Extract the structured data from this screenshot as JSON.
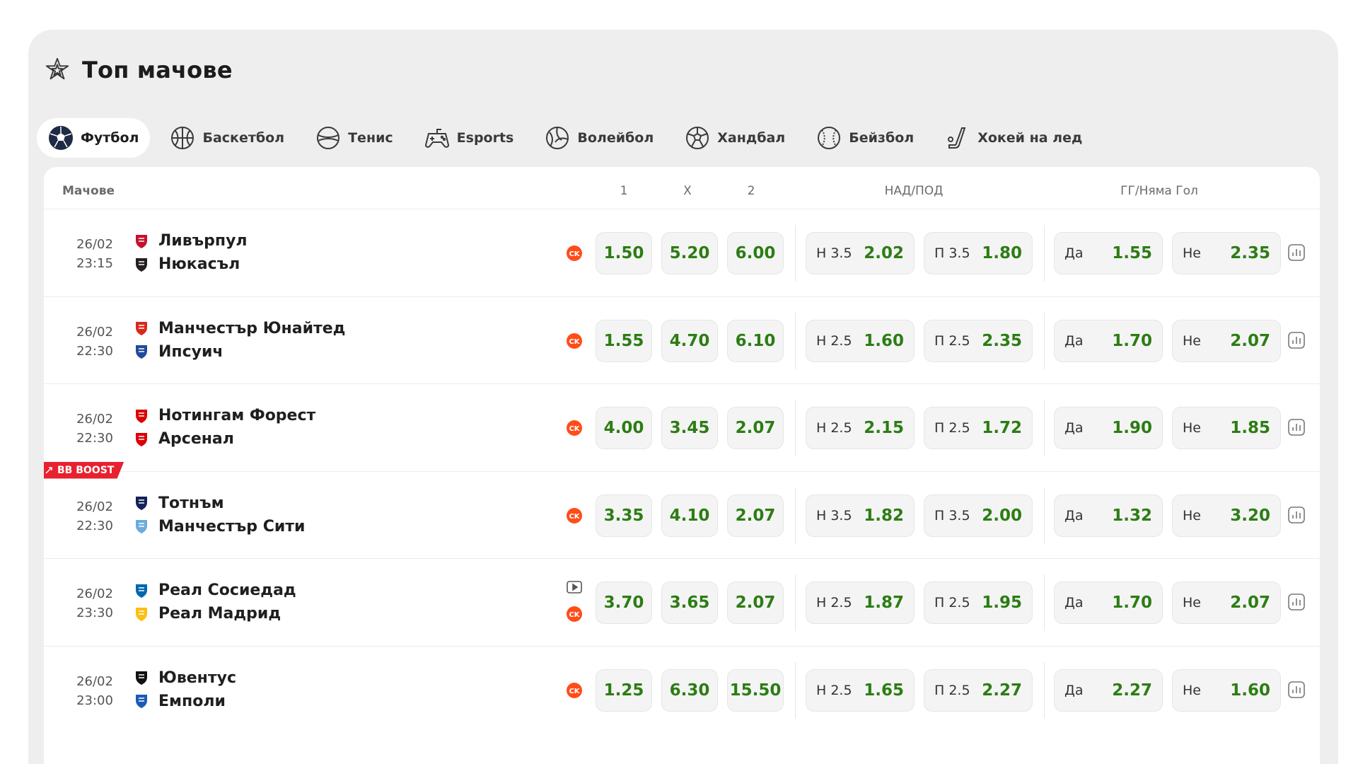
{
  "header": {
    "title": "Топ мачове",
    "icon": "stars-icon"
  },
  "tabs": [
    {
      "label": "Футбол",
      "icon": "football-icon",
      "active": true
    },
    {
      "label": "Баскетбол",
      "icon": "basketball-icon",
      "active": false
    },
    {
      "label": "Тенис",
      "icon": "tennis-icon",
      "active": false
    },
    {
      "label": "Esports",
      "icon": "gamepad-icon",
      "active": false
    },
    {
      "label": "Волейбол",
      "icon": "volleyball-icon",
      "active": false
    },
    {
      "label": "Хандбал",
      "icon": "handball-icon",
      "active": false
    },
    {
      "label": "Бейзбол",
      "icon": "baseball-icon",
      "active": false
    },
    {
      "label": "Хокей на лед",
      "icon": "hockey-icon",
      "active": false
    }
  ],
  "table_header": {
    "matches": "Мачове",
    "col1": "1",
    "colx": "X",
    "col2": "2",
    "over_under": "НАД/ПОД",
    "btts": "ГГ/Няма Гол"
  },
  "colors": {
    "odds_green": "#2c7d14",
    "ck_orange": "#ff4d1a",
    "boost_red": "#e8212f"
  },
  "matches": [
    {
      "date": "26/02",
      "time": "23:15",
      "home": "Ливърпул",
      "away": "Нюкасъл",
      "odd1": "1.50",
      "oddx": "5.20",
      "odd2": "6.00",
      "over_label": "Н 3.5",
      "over": "2.02",
      "under_label": "П 3.5",
      "under": "1.80",
      "yes_label": "Да",
      "yes": "1.55",
      "no_label": "Не",
      "no": "2.35"
    },
    {
      "date": "26/02",
      "time": "22:30",
      "home": "Манчестър Юнайтед",
      "away": "Ипсуич",
      "odd1": "1.55",
      "oddx": "4.70",
      "odd2": "6.10",
      "over_label": "Н 2.5",
      "over": "1.60",
      "under_label": "П 2.5",
      "under": "2.35",
      "yes_label": "Да",
      "yes": "1.70",
      "no_label": "Не",
      "no": "2.07"
    },
    {
      "date": "26/02",
      "time": "22:30",
      "home": "Нотингам Форест",
      "away": "Арсенал",
      "odd1": "4.00",
      "oddx": "3.45",
      "odd2": "2.07",
      "over_label": "Н 2.5",
      "over": "2.15",
      "under_label": "П 2.5",
      "under": "1.72",
      "yes_label": "Да",
      "yes": "1.90",
      "no_label": "Не",
      "no": "1.85"
    },
    {
      "date": "26/02",
      "time": "22:30",
      "home": "Тотнъм",
      "away": "Манчестър Сити",
      "boost": "BB BOOST",
      "odd1": "3.35",
      "oddx": "4.10",
      "odd2": "2.07",
      "over_label": "Н 3.5",
      "over": "1.82",
      "under_label": "П 3.5",
      "under": "2.00",
      "yes_label": "Да",
      "yes": "1.32",
      "no_label": "Не",
      "no": "3.20"
    },
    {
      "date": "26/02",
      "time": "23:30",
      "home": "Реал Сосиедад",
      "away": "Реал Мадрид",
      "odd1": "3.70",
      "oddx": "3.65",
      "odd2": "2.07",
      "over_label": "Н 2.5",
      "over": "1.87",
      "under_label": "П 2.5",
      "under": "1.95",
      "yes_label": "Да",
      "yes": "1.70",
      "no_label": "Не",
      "no": "2.07"
    },
    {
      "date": "26/02",
      "time": "23:00",
      "home": "Ювентус",
      "away": "Емполи",
      "odd1": "1.25",
      "oddx": "6.30",
      "odd2": "15.50",
      "over_label": "Н 2.5",
      "over": "1.65",
      "under_label": "П 2.5",
      "under": "2.27",
      "yes_label": "Да",
      "yes": "2.27",
      "no_label": "Не",
      "no": "1.60"
    }
  ]
}
